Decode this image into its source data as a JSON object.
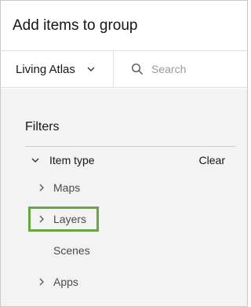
{
  "dialog": {
    "title": "Add items to group"
  },
  "toolbar": {
    "source_label": "Living Atlas",
    "search_placeholder": "Search",
    "search_value": ""
  },
  "filters": {
    "heading": "Filters",
    "item_type": {
      "label": "Item type",
      "clear_label": "Clear",
      "expanded": true,
      "options": [
        {
          "label": "Maps",
          "has_children": true
        },
        {
          "label": "Layers",
          "has_children": true,
          "highlighted": true
        },
        {
          "label": "Scenes",
          "has_children": false
        },
        {
          "label": "Apps",
          "has_children": true
        }
      ]
    }
  },
  "colors": {
    "highlight": "#67a73f",
    "panel_background": "#f3f3f3"
  }
}
